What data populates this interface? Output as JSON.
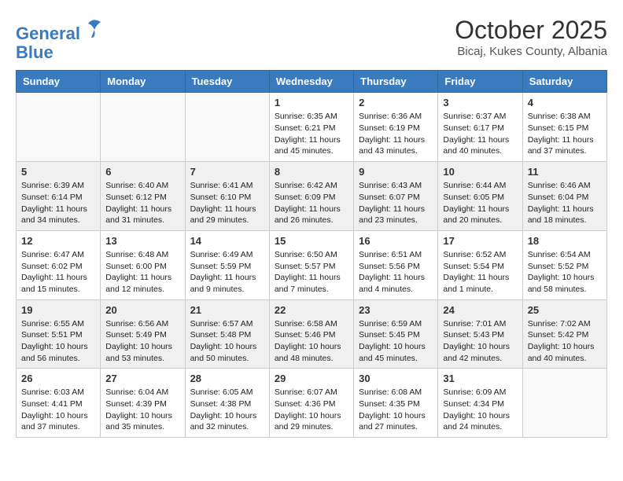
{
  "logo": {
    "line1": "General",
    "line2": "Blue"
  },
  "title": "October 2025",
  "location": "Bicaj, Kukes County, Albania",
  "days_of_week": [
    "Sunday",
    "Monday",
    "Tuesday",
    "Wednesday",
    "Thursday",
    "Friday",
    "Saturday"
  ],
  "weeks": [
    {
      "shade": false,
      "days": [
        {
          "num": "",
          "info": ""
        },
        {
          "num": "",
          "info": ""
        },
        {
          "num": "",
          "info": ""
        },
        {
          "num": "1",
          "info": "Sunrise: 6:35 AM\nSunset: 6:21 PM\nDaylight: 11 hours and 45 minutes."
        },
        {
          "num": "2",
          "info": "Sunrise: 6:36 AM\nSunset: 6:19 PM\nDaylight: 11 hours and 43 minutes."
        },
        {
          "num": "3",
          "info": "Sunrise: 6:37 AM\nSunset: 6:17 PM\nDaylight: 11 hours and 40 minutes."
        },
        {
          "num": "4",
          "info": "Sunrise: 6:38 AM\nSunset: 6:15 PM\nDaylight: 11 hours and 37 minutes."
        }
      ]
    },
    {
      "shade": true,
      "days": [
        {
          "num": "5",
          "info": "Sunrise: 6:39 AM\nSunset: 6:14 PM\nDaylight: 11 hours and 34 minutes."
        },
        {
          "num": "6",
          "info": "Sunrise: 6:40 AM\nSunset: 6:12 PM\nDaylight: 11 hours and 31 minutes."
        },
        {
          "num": "7",
          "info": "Sunrise: 6:41 AM\nSunset: 6:10 PM\nDaylight: 11 hours and 29 minutes."
        },
        {
          "num": "8",
          "info": "Sunrise: 6:42 AM\nSunset: 6:09 PM\nDaylight: 11 hours and 26 minutes."
        },
        {
          "num": "9",
          "info": "Sunrise: 6:43 AM\nSunset: 6:07 PM\nDaylight: 11 hours and 23 minutes."
        },
        {
          "num": "10",
          "info": "Sunrise: 6:44 AM\nSunset: 6:05 PM\nDaylight: 11 hours and 20 minutes."
        },
        {
          "num": "11",
          "info": "Sunrise: 6:46 AM\nSunset: 6:04 PM\nDaylight: 11 hours and 18 minutes."
        }
      ]
    },
    {
      "shade": false,
      "days": [
        {
          "num": "12",
          "info": "Sunrise: 6:47 AM\nSunset: 6:02 PM\nDaylight: 11 hours and 15 minutes."
        },
        {
          "num": "13",
          "info": "Sunrise: 6:48 AM\nSunset: 6:00 PM\nDaylight: 11 hours and 12 minutes."
        },
        {
          "num": "14",
          "info": "Sunrise: 6:49 AM\nSunset: 5:59 PM\nDaylight: 11 hours and 9 minutes."
        },
        {
          "num": "15",
          "info": "Sunrise: 6:50 AM\nSunset: 5:57 PM\nDaylight: 11 hours and 7 minutes."
        },
        {
          "num": "16",
          "info": "Sunrise: 6:51 AM\nSunset: 5:56 PM\nDaylight: 11 hours and 4 minutes."
        },
        {
          "num": "17",
          "info": "Sunrise: 6:52 AM\nSunset: 5:54 PM\nDaylight: 11 hours and 1 minute."
        },
        {
          "num": "18",
          "info": "Sunrise: 6:54 AM\nSunset: 5:52 PM\nDaylight: 10 hours and 58 minutes."
        }
      ]
    },
    {
      "shade": true,
      "days": [
        {
          "num": "19",
          "info": "Sunrise: 6:55 AM\nSunset: 5:51 PM\nDaylight: 10 hours and 56 minutes."
        },
        {
          "num": "20",
          "info": "Sunrise: 6:56 AM\nSunset: 5:49 PM\nDaylight: 10 hours and 53 minutes."
        },
        {
          "num": "21",
          "info": "Sunrise: 6:57 AM\nSunset: 5:48 PM\nDaylight: 10 hours and 50 minutes."
        },
        {
          "num": "22",
          "info": "Sunrise: 6:58 AM\nSunset: 5:46 PM\nDaylight: 10 hours and 48 minutes."
        },
        {
          "num": "23",
          "info": "Sunrise: 6:59 AM\nSunset: 5:45 PM\nDaylight: 10 hours and 45 minutes."
        },
        {
          "num": "24",
          "info": "Sunrise: 7:01 AM\nSunset: 5:43 PM\nDaylight: 10 hours and 42 minutes."
        },
        {
          "num": "25",
          "info": "Sunrise: 7:02 AM\nSunset: 5:42 PM\nDaylight: 10 hours and 40 minutes."
        }
      ]
    },
    {
      "shade": false,
      "days": [
        {
          "num": "26",
          "info": "Sunrise: 6:03 AM\nSunset: 4:41 PM\nDaylight: 10 hours and 37 minutes."
        },
        {
          "num": "27",
          "info": "Sunrise: 6:04 AM\nSunset: 4:39 PM\nDaylight: 10 hours and 35 minutes."
        },
        {
          "num": "28",
          "info": "Sunrise: 6:05 AM\nSunset: 4:38 PM\nDaylight: 10 hours and 32 minutes."
        },
        {
          "num": "29",
          "info": "Sunrise: 6:07 AM\nSunset: 4:36 PM\nDaylight: 10 hours and 29 minutes."
        },
        {
          "num": "30",
          "info": "Sunrise: 6:08 AM\nSunset: 4:35 PM\nDaylight: 10 hours and 27 minutes."
        },
        {
          "num": "31",
          "info": "Sunrise: 6:09 AM\nSunset: 4:34 PM\nDaylight: 10 hours and 24 minutes."
        },
        {
          "num": "",
          "info": ""
        }
      ]
    }
  ]
}
